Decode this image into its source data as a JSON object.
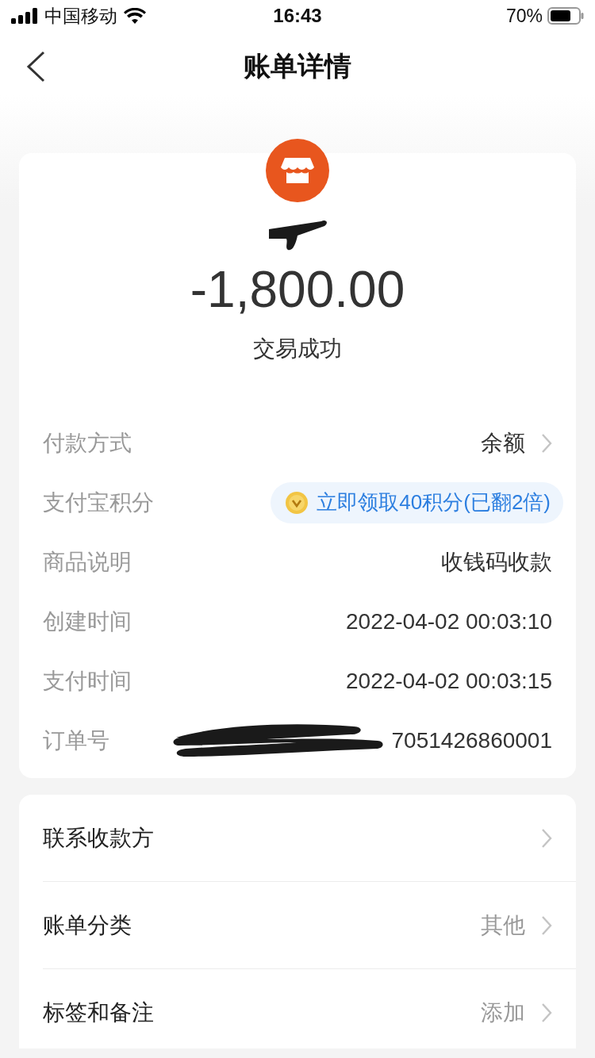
{
  "status_bar": {
    "carrier": "中国移动",
    "time": "16:43",
    "battery": "70%"
  },
  "nav": {
    "title": "账单详情"
  },
  "bill": {
    "amount": "-1,800.00",
    "status": "交易成功"
  },
  "details": [
    {
      "kind": "link",
      "label": "付款方式",
      "value": "余额"
    },
    {
      "kind": "badge",
      "label": "支付宝积分",
      "value": "立即领取40积分(已翻2倍)"
    },
    {
      "kind": "plain",
      "label": "商品说明",
      "value": "收钱码收款"
    },
    {
      "kind": "plain",
      "label": "创建时间",
      "value": "2022-04-02 00:03:10"
    },
    {
      "kind": "plain",
      "label": "支付时间",
      "value": "2022-04-02 00:03:15"
    },
    {
      "kind": "redacted",
      "label": "订单号",
      "value": "7051426860001"
    }
  ],
  "actions": [
    {
      "label": "联系收款方"
    },
    {
      "label": "账单分类",
      "value": "其他"
    },
    {
      "label": "标签和备注",
      "value": "添加"
    }
  ]
}
